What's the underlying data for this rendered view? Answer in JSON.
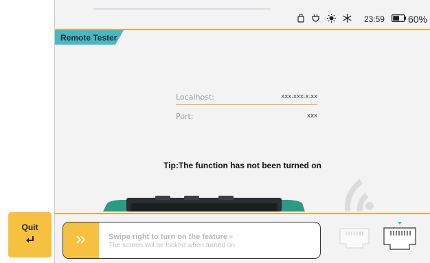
{
  "app": {
    "title": "Remote Tester"
  },
  "left_rail": {
    "quit_label": "Quit",
    "quit_icon": "return-arrow-icon"
  },
  "status_bar": {
    "icons": [
      "usb-icon",
      "power-plug-icon",
      "brightness-icon",
      "cooling-icon"
    ],
    "time": "23:59",
    "battery_percent": "60%",
    "battery_level": 0.6
  },
  "form": {
    "localhost_label": "Localhost:",
    "localhost_value": "xxx.xxx.x.xx",
    "port_label": "Port:",
    "port_value": "xxx"
  },
  "tip": "Tip:The function has not been turned on",
  "swipe": {
    "title": "Swipe right to turn on the feature",
    "subtitle": "The screen will be locked when turned on.",
    "handle_icon": "double-chevron-right-icon"
  },
  "ports": {
    "left_icon": "ethernet-port-icon-inactive",
    "right_icon": "ethernet-port-icon-active"
  },
  "colors": {
    "accent": "#f6c141",
    "tab": "#49b8c6",
    "rule": "#f4a63a",
    "device": "#2a9c86"
  }
}
